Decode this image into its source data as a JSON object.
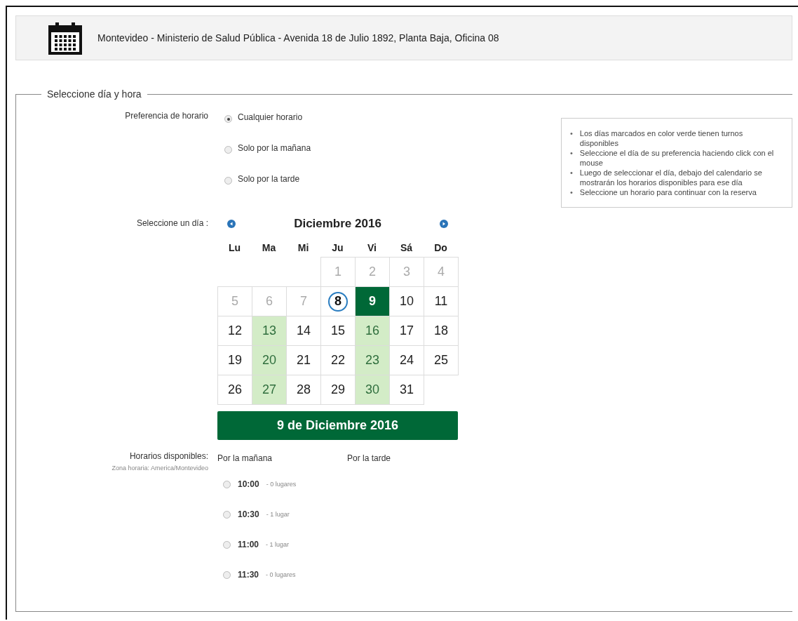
{
  "header": {
    "location": "Montevideo - Ministerio de Salud Pública - Avenida 18 de Julio 1892, Planta Baja, Oficina 08"
  },
  "section": {
    "legend": "Seleccione día y hora"
  },
  "preference": {
    "label": "Preferencia de horario",
    "options": [
      {
        "label": "Cualquier horario",
        "selected": true
      },
      {
        "label": "Solo por la mañana",
        "selected": false
      },
      {
        "label": "Solo por la tarde",
        "selected": false
      }
    ]
  },
  "calendar": {
    "label": "Seleccione un día :",
    "month": "Diciembre 2016",
    "weekdays": [
      "Lu",
      "Ma",
      "Mi",
      "Ju",
      "Vi",
      "Sá",
      "Do"
    ],
    "weeks": [
      [
        {
          "kind": "blank"
        },
        {
          "kind": "blank"
        },
        {
          "kind": "blank"
        },
        {
          "day": "1",
          "kind": "past"
        },
        {
          "day": "2",
          "kind": "past"
        },
        {
          "day": "3",
          "kind": "past"
        },
        {
          "day": "4",
          "kind": "past"
        }
      ],
      [
        {
          "day": "5",
          "kind": "past"
        },
        {
          "day": "6",
          "kind": "past"
        },
        {
          "day": "7",
          "kind": "past"
        },
        {
          "day": "8",
          "kind": "today"
        },
        {
          "day": "9",
          "kind": "selected"
        },
        {
          "day": "10",
          "kind": "plain"
        },
        {
          "day": "11",
          "kind": "plain"
        }
      ],
      [
        {
          "day": "12",
          "kind": "plain"
        },
        {
          "day": "13",
          "kind": "available"
        },
        {
          "day": "14",
          "kind": "plain"
        },
        {
          "day": "15",
          "kind": "plain"
        },
        {
          "day": "16",
          "kind": "available"
        },
        {
          "day": "17",
          "kind": "plain"
        },
        {
          "day": "18",
          "kind": "plain"
        }
      ],
      [
        {
          "day": "19",
          "kind": "plain"
        },
        {
          "day": "20",
          "kind": "available"
        },
        {
          "day": "21",
          "kind": "plain"
        },
        {
          "day": "22",
          "kind": "plain"
        },
        {
          "day": "23",
          "kind": "available"
        },
        {
          "day": "24",
          "kind": "plain"
        },
        {
          "day": "25",
          "kind": "plain"
        }
      ],
      [
        {
          "day": "26",
          "kind": "plain"
        },
        {
          "day": "27",
          "kind": "available"
        },
        {
          "day": "28",
          "kind": "plain"
        },
        {
          "day": "29",
          "kind": "plain"
        },
        {
          "day": "30",
          "kind": "available"
        },
        {
          "day": "31",
          "kind": "plain"
        },
        {
          "kind": "blank"
        }
      ]
    ]
  },
  "selected_date": "9 de Diciembre 2016",
  "slots": {
    "label": "Horarios disponibles:",
    "timezone": "Zona horaria: America/Montevideo",
    "morning_heading": "Por la mañana",
    "afternoon_heading": "Por la tarde",
    "morning": [
      {
        "time": "10:00",
        "places": "- 0 lugares",
        "selected": false
      },
      {
        "time": "10:30",
        "places": "- 1 lugar",
        "selected": false
      },
      {
        "time": "11:00",
        "places": "- 1 lugar",
        "selected": false
      },
      {
        "time": "11:30",
        "places": "- 0 lugares",
        "selected": false
      }
    ]
  },
  "help": {
    "items": [
      {
        "bullet": "•",
        "text": "Los días marcados en color verde tienen turnos disponibles"
      },
      {
        "bullet": "•",
        "text": "Seleccione el día de su preferencia haciendo click con el mouse"
      },
      {
        "bullet": "•",
        "text": "Luego de seleccionar el día, debajo del calendario se mostrarán los horarios disponibles para ese día"
      },
      {
        "bullet": "•",
        "text": "Seleccione un horario para continuar con la reserva"
      }
    ]
  }
}
